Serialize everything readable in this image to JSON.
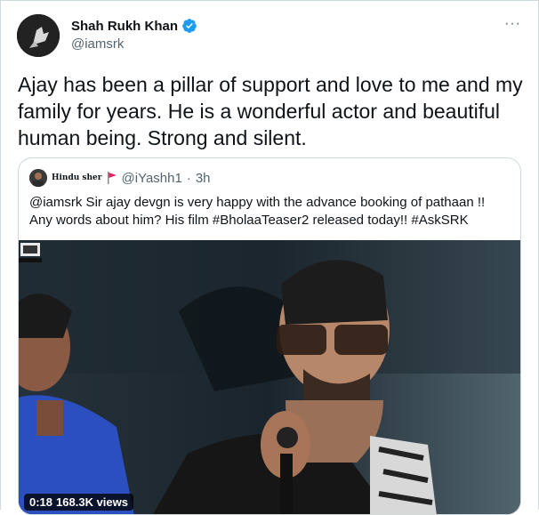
{
  "tweet": {
    "author_name": "Shah Rukh Khan",
    "author_handle": "@iamsrk",
    "more_label": "···",
    "text": "Ajay has been a pillar of support and love to me and my family for years. He is a wonderful actor and beautiful human being. Strong and silent."
  },
  "quoted": {
    "display_name": "Hindu sher",
    "handle": "@iYashh1",
    "separator": "·",
    "time": "3h",
    "text": "@iamsrk Sir ajay devgn is very happy with the advance booking of pathaan !! Any words about him? His film #BholaaTeaser2 released today!! #AskSRK",
    "video": {
      "duration": "0:18",
      "views": "168.3K views",
      "watermark_icon": "lehren-logo-icon"
    }
  },
  "colors": {
    "verified": "#1d9bf0",
    "secondary_text": "#536471",
    "border": "#cfd9de",
    "flag": "#e0245e"
  }
}
